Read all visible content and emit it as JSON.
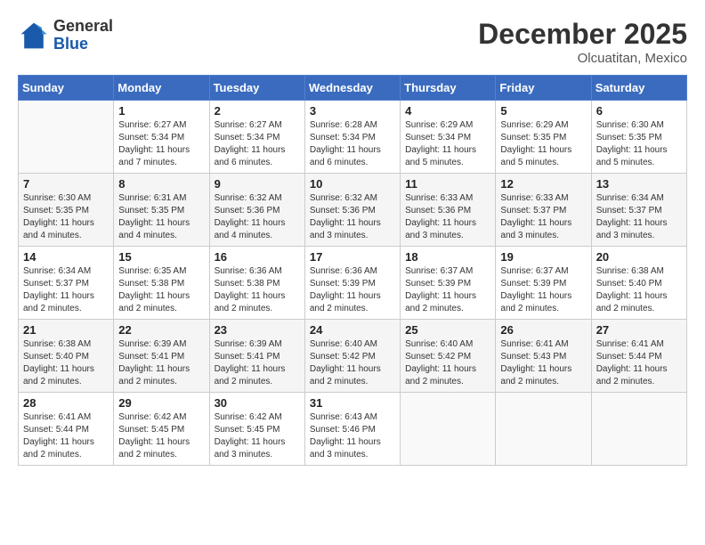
{
  "header": {
    "logo_line1": "General",
    "logo_line2": "Blue",
    "month": "December 2025",
    "location": "Olcuatitan, Mexico"
  },
  "days_of_week": [
    "Sunday",
    "Monday",
    "Tuesday",
    "Wednesday",
    "Thursday",
    "Friday",
    "Saturday"
  ],
  "weeks": [
    [
      {
        "day": "",
        "info": ""
      },
      {
        "day": "1",
        "info": "Sunrise: 6:27 AM\nSunset: 5:34 PM\nDaylight: 11 hours\nand 7 minutes."
      },
      {
        "day": "2",
        "info": "Sunrise: 6:27 AM\nSunset: 5:34 PM\nDaylight: 11 hours\nand 6 minutes."
      },
      {
        "day": "3",
        "info": "Sunrise: 6:28 AM\nSunset: 5:34 PM\nDaylight: 11 hours\nand 6 minutes."
      },
      {
        "day": "4",
        "info": "Sunrise: 6:29 AM\nSunset: 5:34 PM\nDaylight: 11 hours\nand 5 minutes."
      },
      {
        "day": "5",
        "info": "Sunrise: 6:29 AM\nSunset: 5:35 PM\nDaylight: 11 hours\nand 5 minutes."
      },
      {
        "day": "6",
        "info": "Sunrise: 6:30 AM\nSunset: 5:35 PM\nDaylight: 11 hours\nand 5 minutes."
      }
    ],
    [
      {
        "day": "7",
        "info": "Sunrise: 6:30 AM\nSunset: 5:35 PM\nDaylight: 11 hours\nand 4 minutes."
      },
      {
        "day": "8",
        "info": "Sunrise: 6:31 AM\nSunset: 5:35 PM\nDaylight: 11 hours\nand 4 minutes."
      },
      {
        "day": "9",
        "info": "Sunrise: 6:32 AM\nSunset: 5:36 PM\nDaylight: 11 hours\nand 4 minutes."
      },
      {
        "day": "10",
        "info": "Sunrise: 6:32 AM\nSunset: 5:36 PM\nDaylight: 11 hours\nand 3 minutes."
      },
      {
        "day": "11",
        "info": "Sunrise: 6:33 AM\nSunset: 5:36 PM\nDaylight: 11 hours\nand 3 minutes."
      },
      {
        "day": "12",
        "info": "Sunrise: 6:33 AM\nSunset: 5:37 PM\nDaylight: 11 hours\nand 3 minutes."
      },
      {
        "day": "13",
        "info": "Sunrise: 6:34 AM\nSunset: 5:37 PM\nDaylight: 11 hours\nand 3 minutes."
      }
    ],
    [
      {
        "day": "14",
        "info": "Sunrise: 6:34 AM\nSunset: 5:37 PM\nDaylight: 11 hours\nand 2 minutes."
      },
      {
        "day": "15",
        "info": "Sunrise: 6:35 AM\nSunset: 5:38 PM\nDaylight: 11 hours\nand 2 minutes."
      },
      {
        "day": "16",
        "info": "Sunrise: 6:36 AM\nSunset: 5:38 PM\nDaylight: 11 hours\nand 2 minutes."
      },
      {
        "day": "17",
        "info": "Sunrise: 6:36 AM\nSunset: 5:39 PM\nDaylight: 11 hours\nand 2 minutes."
      },
      {
        "day": "18",
        "info": "Sunrise: 6:37 AM\nSunset: 5:39 PM\nDaylight: 11 hours\nand 2 minutes."
      },
      {
        "day": "19",
        "info": "Sunrise: 6:37 AM\nSunset: 5:39 PM\nDaylight: 11 hours\nand 2 minutes."
      },
      {
        "day": "20",
        "info": "Sunrise: 6:38 AM\nSunset: 5:40 PM\nDaylight: 11 hours\nand 2 minutes."
      }
    ],
    [
      {
        "day": "21",
        "info": "Sunrise: 6:38 AM\nSunset: 5:40 PM\nDaylight: 11 hours\nand 2 minutes."
      },
      {
        "day": "22",
        "info": "Sunrise: 6:39 AM\nSunset: 5:41 PM\nDaylight: 11 hours\nand 2 minutes."
      },
      {
        "day": "23",
        "info": "Sunrise: 6:39 AM\nSunset: 5:41 PM\nDaylight: 11 hours\nand 2 minutes."
      },
      {
        "day": "24",
        "info": "Sunrise: 6:40 AM\nSunset: 5:42 PM\nDaylight: 11 hours\nand 2 minutes."
      },
      {
        "day": "25",
        "info": "Sunrise: 6:40 AM\nSunset: 5:42 PM\nDaylight: 11 hours\nand 2 minutes."
      },
      {
        "day": "26",
        "info": "Sunrise: 6:41 AM\nSunset: 5:43 PM\nDaylight: 11 hours\nand 2 minutes."
      },
      {
        "day": "27",
        "info": "Sunrise: 6:41 AM\nSunset: 5:44 PM\nDaylight: 11 hours\nand 2 minutes."
      }
    ],
    [
      {
        "day": "28",
        "info": "Sunrise: 6:41 AM\nSunset: 5:44 PM\nDaylight: 11 hours\nand 2 minutes."
      },
      {
        "day": "29",
        "info": "Sunrise: 6:42 AM\nSunset: 5:45 PM\nDaylight: 11 hours\nand 2 minutes."
      },
      {
        "day": "30",
        "info": "Sunrise: 6:42 AM\nSunset: 5:45 PM\nDaylight: 11 hours\nand 3 minutes."
      },
      {
        "day": "31",
        "info": "Sunrise: 6:43 AM\nSunset: 5:46 PM\nDaylight: 11 hours\nand 3 minutes."
      },
      {
        "day": "",
        "info": ""
      },
      {
        "day": "",
        "info": ""
      },
      {
        "day": "",
        "info": ""
      }
    ]
  ]
}
